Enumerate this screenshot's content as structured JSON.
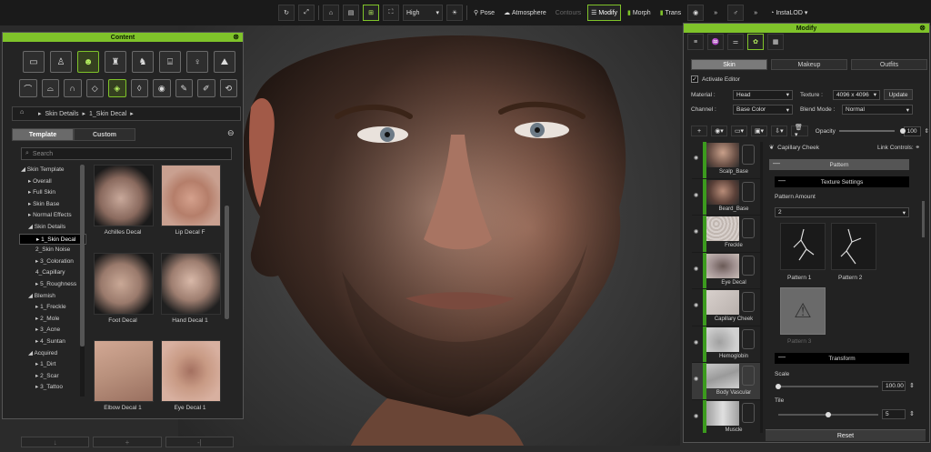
{
  "toolbar": {
    "quality": "High",
    "pose": "Pose",
    "atmosphere": "Atmosphere",
    "contours": "Contours",
    "modify": "Modify",
    "morph": "Morph",
    "trans": "Trans",
    "instalod": "InstaLOD",
    "more": "»"
  },
  "content_panel": {
    "title": "Content",
    "close": "⊗",
    "breadcrumb": [
      "Skin Details",
      "1_Skin Decal"
    ],
    "tabs": [
      "Template",
      "Custom"
    ],
    "search_placeholder": "Search",
    "tree": [
      {
        "label": "◢ Skin Template",
        "indent": 0
      },
      {
        "label": "▸ Overall",
        "indent": 1
      },
      {
        "label": "▸ Full Skin",
        "indent": 1
      },
      {
        "label": "▸ Skin Base",
        "indent": 1
      },
      {
        "label": "▸ Normal Effects",
        "indent": 1
      },
      {
        "label": "◢ Skin Details",
        "indent": 1
      },
      {
        "label": "▸ 1_Skin Decal",
        "indent": 2,
        "selected": true
      },
      {
        "label": "2_Skin Noise",
        "indent": 2
      },
      {
        "label": "▸ 3_Coloration",
        "indent": 2
      },
      {
        "label": "4_Capillary",
        "indent": 2
      },
      {
        "label": "▸ 5_Roughness",
        "indent": 2
      },
      {
        "label": "◢ Blemish",
        "indent": 1
      },
      {
        "label": "▸ 1_Freckle",
        "indent": 2
      },
      {
        "label": "▸ 2_Mole",
        "indent": 2
      },
      {
        "label": "▸ 3_Acne",
        "indent": 2
      },
      {
        "label": "▸ 4_Suntan",
        "indent": 2
      },
      {
        "label": "◢ Acquired",
        "indent": 1
      },
      {
        "label": "▸ 1_Dirt",
        "indent": 2
      },
      {
        "label": "▸ 2_Scar",
        "indent": 2
      },
      {
        "label": "▸ 3_Tattoo",
        "indent": 2
      }
    ],
    "thumbnails": [
      {
        "label": "Achilles Decal"
      },
      {
        "label": "Lip Decal F"
      },
      {
        "label": "Foot Decal"
      },
      {
        "label": "Hand Decal 1"
      },
      {
        "label": "Elbow Decal 1"
      },
      {
        "label": "Eye Decal 1"
      }
    ],
    "bottom_buttons": [
      "↓",
      "+",
      "-|"
    ]
  },
  "modify_panel": {
    "title": "Modify",
    "close": "⊗",
    "subtabs": [
      "Skin",
      "Makeup",
      "Outfits"
    ],
    "activate_editor": "Activate Editor",
    "material_label": "Material :",
    "material_value": "Head",
    "texture_label": "Texture :",
    "texture_value": "4096 x 4096",
    "update_label": "Update",
    "channel_label": "Channel :",
    "channel_value": "Base Color",
    "blend_mode_label": "Blend Mode :",
    "blend_mode_value": "Normal",
    "opacity_label": "Opacity",
    "opacity_value": "100",
    "opacity_fraction": 1.0,
    "layers": [
      {
        "label": "Scalp_Base"
      },
      {
        "label": "Beard_Base"
      },
      {
        "label": "Freckle"
      },
      {
        "label": "Eye Decal"
      },
      {
        "label": "Capillary Cheek"
      },
      {
        "label": "Hemoglobin"
      },
      {
        "label": "Body Vascular",
        "selected": true
      },
      {
        "label": "Muscle"
      }
    ],
    "current_layer": "Capillary Cheek",
    "link_controls": "Link Controls:",
    "pattern_header": "Pattern",
    "texture_settings": "Texture Settings",
    "pattern_amount_label": "Pattern Amount",
    "pattern_amount_value": "2",
    "patterns": [
      "Pattern 1",
      "Pattern 2",
      "Pattern 3"
    ],
    "transform_header": "Transform",
    "scale_label": "Scale",
    "scale_value": "100.00",
    "scale_fraction": 0.0,
    "tile_label": "Tile",
    "tile_value": "5",
    "tile_fraction": 0.5,
    "reset_label": "Reset",
    "collapse": "—"
  },
  "colors": {
    "accent": "#7fc32a",
    "layer_bar": "#3c9b1e"
  }
}
